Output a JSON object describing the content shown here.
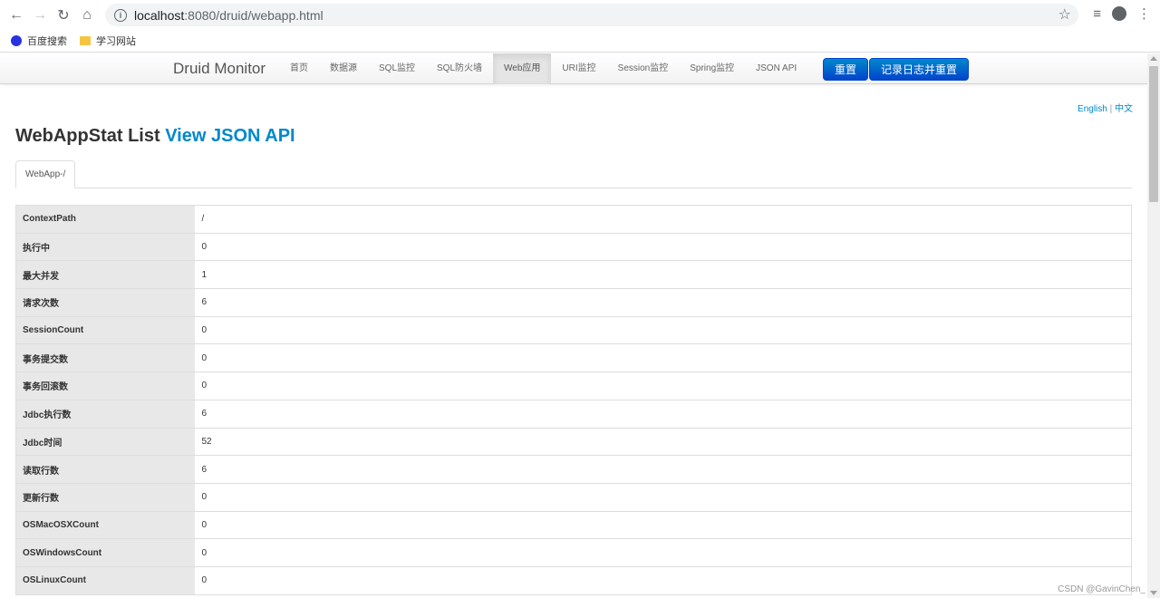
{
  "browser": {
    "url_host": "localhost",
    "url_rest": ":8080/druid/webapp.html",
    "bookmarks": [
      {
        "label": "百度搜索",
        "icon": "baidu-paw-icon"
      },
      {
        "label": "学习网站",
        "icon": "folder-icon"
      }
    ]
  },
  "navbar": {
    "brand": "Druid Monitor",
    "items": [
      "首页",
      "数据源",
      "SQL监控",
      "SQL防火墙",
      "Web应用",
      "URI监控",
      "Session监控",
      "Spring监控",
      "JSON API"
    ],
    "active_index": 4,
    "reset_label": "重置",
    "log_reset_label": "记录日志并重置"
  },
  "lang": {
    "english": "English",
    "sep": " | ",
    "chinese": "中文"
  },
  "page": {
    "title": "WebAppStat List",
    "json_link": "View JSON API",
    "tab": "WebApp-/"
  },
  "stats": [
    {
      "key": "ContextPath",
      "value": "/"
    },
    {
      "key": "执行中",
      "value": "0"
    },
    {
      "key": "最大并发",
      "value": "1"
    },
    {
      "key": "请求次数",
      "value": "6"
    },
    {
      "key": "SessionCount",
      "value": "0"
    },
    {
      "key": "事务提交数",
      "value": "0"
    },
    {
      "key": "事务回滚数",
      "value": "0"
    },
    {
      "key": "Jdbc执行数",
      "value": "6"
    },
    {
      "key": "Jdbc时间",
      "value": "52"
    },
    {
      "key": "读取行数",
      "value": "6"
    },
    {
      "key": "更新行数",
      "value": "0"
    },
    {
      "key": "OSMacOSXCount",
      "value": "0"
    },
    {
      "key": "OSWindowsCount",
      "value": "0"
    },
    {
      "key": "OSLinuxCount",
      "value": "0"
    }
  ],
  "watermark": "CSDN @GavinChen_",
  "colors": {
    "link": "#0088cc",
    "button": "#0044cc",
    "key_cell": "#e8e8e8"
  }
}
